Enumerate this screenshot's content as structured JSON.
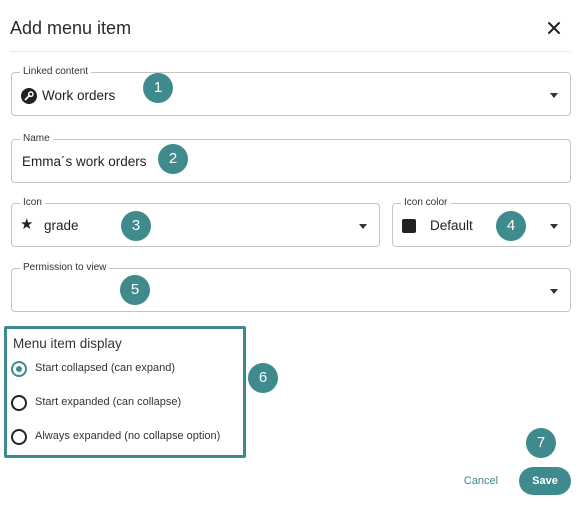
{
  "dialog": {
    "title": "Add menu item",
    "close_icon": "close-icon"
  },
  "fields": {
    "linked_content": {
      "label": "Linked content",
      "value": "Work orders",
      "icon": "wrench-icon"
    },
    "name": {
      "label": "Name",
      "value": "Emma´s work orders"
    },
    "icon": {
      "label": "Icon",
      "value": "grade",
      "icon": "star-icon"
    },
    "icon_color": {
      "label": "Icon color",
      "value": "Default",
      "swatch_color": "#222222"
    },
    "permission": {
      "label": "Permission to view",
      "value": ""
    }
  },
  "display": {
    "title": "Menu item display",
    "options": [
      {
        "label": "Start collapsed (can expand)",
        "selected": true
      },
      {
        "label": "Start expanded (can collapse)",
        "selected": false
      },
      {
        "label": "Always expanded (no collapse option)",
        "selected": false
      }
    ]
  },
  "callouts": [
    "1",
    "2",
    "3",
    "4",
    "5",
    "6",
    "7"
  ],
  "actions": {
    "cancel_label": "Cancel",
    "save_label": "Save"
  },
  "colors": {
    "accent": "#3f8a8c",
    "border": "#c4c4c4"
  }
}
